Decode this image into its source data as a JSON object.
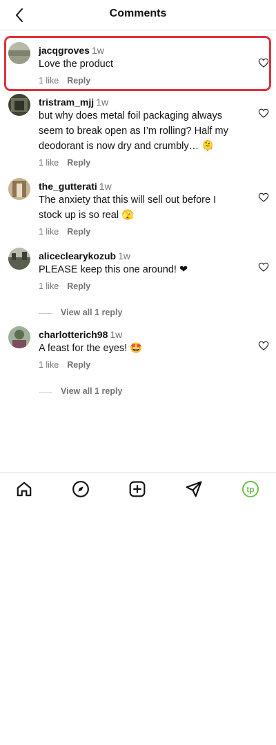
{
  "header": {
    "title": "Comments"
  },
  "comments": [
    {
      "username": "jacqgroves",
      "time": "1w",
      "text": "Love the product",
      "likes": "1 like",
      "reply": "Reply",
      "avatar_color": "#8a8f7e"
    },
    {
      "username": "tristram_mjj",
      "time": "1w",
      "text": "but why does metal foil packaging always seem to break open as I’m rolling? Half my deodorant is now dry and crumbly… 🫠",
      "likes": "1 like",
      "reply": "Reply",
      "avatar_color": "#4c5240"
    },
    {
      "username": "the_gutterati",
      "time": "1w",
      "text": "The anxiety that this will sell out before I stock up is so real 🫣",
      "likes": "1 like",
      "reply": "Reply",
      "avatar_color": "#a69074"
    },
    {
      "username": "aliceclearykozub",
      "time": "1w",
      "text": "PLEASE keep this one around! ❤",
      "likes": "1 like",
      "reply": "Reply",
      "avatar_color": "#6d7266",
      "view_replies": "View all 1 reply"
    },
    {
      "username": "charlotterich98",
      "time": "1w",
      "text": "A feast for the eyes! 🤩",
      "likes": "1 like",
      "reply": "Reply",
      "avatar_color": "#5f7050",
      "view_replies": "View all 1 reply"
    }
  ],
  "nav": {
    "items": [
      "home-icon",
      "explore-icon",
      "create-icon",
      "direct-icon",
      "profile-icon"
    ],
    "profile_initials": "tp",
    "profile_color": "#6cc04a"
  }
}
